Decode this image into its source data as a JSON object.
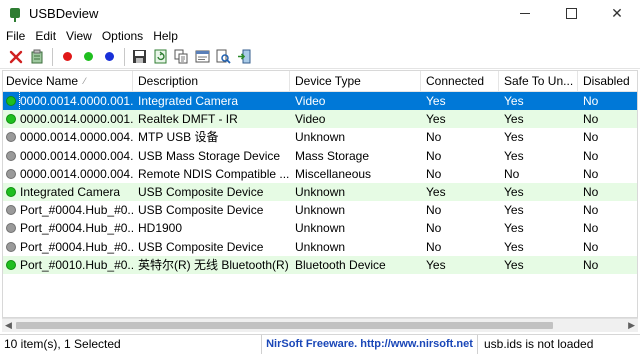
{
  "window": {
    "title": "USBDeview"
  },
  "colors": {
    "selected": "#0078d7",
    "connected_row": "#e6fbe4",
    "green_dot": "#1fbf1f",
    "gray_dot": "#9a9a9a",
    "nirsoft_link": "#1a47b8"
  },
  "menu": [
    {
      "label": "File"
    },
    {
      "label": "Edit"
    },
    {
      "label": "View"
    },
    {
      "label": "Options"
    },
    {
      "label": "Help"
    }
  ],
  "toolbar": {
    "icons": [
      "disconnect-icon",
      "uninstall-icon",
      "red-dot-icon",
      "green-dot-icon",
      "blue-dot-icon",
      "save-icon",
      "refresh-icon",
      "copy-icon",
      "properties-icon",
      "find-icon",
      "exit-icon"
    ]
  },
  "table": {
    "columns": [
      "Device Name",
      "Description",
      "Device Type",
      "Connected",
      "Safe To Un...",
      "Disabled"
    ],
    "rows": [
      {
        "status": "green",
        "selected": true,
        "name": "0000.0014.0000.001....",
        "description": "Integrated Camera",
        "type": "Video",
        "connected": "Yes",
        "safe": "Yes",
        "disabled": "No"
      },
      {
        "status": "green",
        "selected": false,
        "name": "0000.0014.0000.001....",
        "description": "Realtek DMFT - IR",
        "type": "Video",
        "connected": "Yes",
        "safe": "Yes",
        "disabled": "No"
      },
      {
        "status": "gray",
        "selected": false,
        "name": "0000.0014.0000.004....",
        "description": "MTP USB 设备",
        "type": "Unknown",
        "connected": "No",
        "safe": "Yes",
        "disabled": "No"
      },
      {
        "status": "gray",
        "selected": false,
        "name": "0000.0014.0000.004....",
        "description": "USB Mass Storage Device",
        "type": "Mass Storage",
        "connected": "No",
        "safe": "Yes",
        "disabled": "No"
      },
      {
        "status": "gray",
        "selected": false,
        "name": "0000.0014.0000.004....",
        "description": "Remote NDIS Compatible ...",
        "type": "Miscellaneous",
        "connected": "No",
        "safe": "No",
        "disabled": "No"
      },
      {
        "status": "green",
        "selected": false,
        "name": "Integrated Camera",
        "description": "USB Composite Device",
        "type": "Unknown",
        "connected": "Yes",
        "safe": "Yes",
        "disabled": "No"
      },
      {
        "status": "gray",
        "selected": false,
        "name": "Port_#0004.Hub_#0...",
        "description": "USB Composite Device",
        "type": "Unknown",
        "connected": "No",
        "safe": "Yes",
        "disabled": "No"
      },
      {
        "status": "gray",
        "selected": false,
        "name": "Port_#0004.Hub_#0...",
        "description": "HD1900",
        "type": "Unknown",
        "connected": "No",
        "safe": "Yes",
        "disabled": "No"
      },
      {
        "status": "gray",
        "selected": false,
        "name": "Port_#0004.Hub_#0...",
        "description": "USB Composite Device",
        "type": "Unknown",
        "connected": "No",
        "safe": "Yes",
        "disabled": "No"
      },
      {
        "status": "green",
        "selected": false,
        "name": "Port_#0010.Hub_#0...",
        "description": "英特尔(R) 无线 Bluetooth(R)",
        "type": "Bluetooth Device",
        "connected": "Yes",
        "safe": "Yes",
        "disabled": "No"
      }
    ]
  },
  "statusbar": {
    "items": "10 item(s), 1 Selected",
    "credit": "NirSoft Freeware.  http://www.nirsoft.net",
    "ids": "usb.ids is not loaded"
  }
}
